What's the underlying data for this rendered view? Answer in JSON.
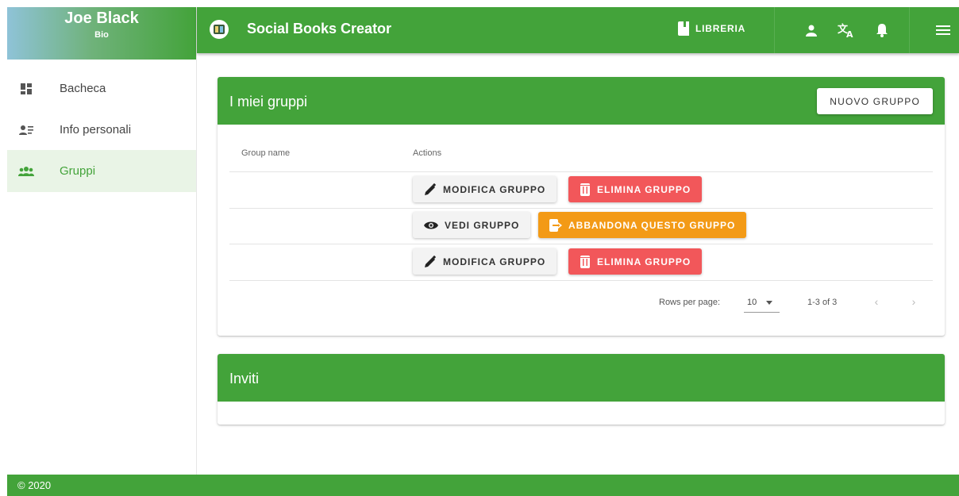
{
  "profile": {
    "name": "Joe Black",
    "bio": "Bio"
  },
  "sidebar": {
    "items": [
      {
        "label": "Bacheca",
        "icon": "dashboard-icon"
      },
      {
        "label": "Info personali",
        "icon": "person-info-icon"
      },
      {
        "label": "Gruppi",
        "icon": "group-icon",
        "active": true
      }
    ]
  },
  "topbar": {
    "title": "Social Books Creator",
    "library_label": "LIBRERIA",
    "icons": [
      "person-icon",
      "translate-icon",
      "bell-icon",
      "menu-icon"
    ]
  },
  "groups_card": {
    "title": "I miei gruppi",
    "new_button": "NUOVO GRUPPO",
    "columns": [
      "Group name",
      "Actions"
    ],
    "rows": [
      {
        "name": "",
        "actions": [
          "MODIFICA GRUPPO",
          "ELIMINA GRUPPO"
        ]
      },
      {
        "name": "",
        "actions": [
          "VEDI GRUPPO",
          "ABBANDONA QUESTO GRUPPO"
        ]
      },
      {
        "name": "",
        "actions": [
          "MODIFICA GRUPPO",
          "ELIMINA GRUPPO"
        ]
      }
    ],
    "pagination": {
      "rows_per_page_label": "Rows per page:",
      "rows_per_page_value": "10",
      "range": "1-3 of 3"
    }
  },
  "invites_card": {
    "title": "Inviti"
  },
  "footer": {
    "text": "© 2020"
  },
  "colors": {
    "primary": "#43a33a",
    "danger": "#f2575a",
    "warning": "#f39a16"
  }
}
